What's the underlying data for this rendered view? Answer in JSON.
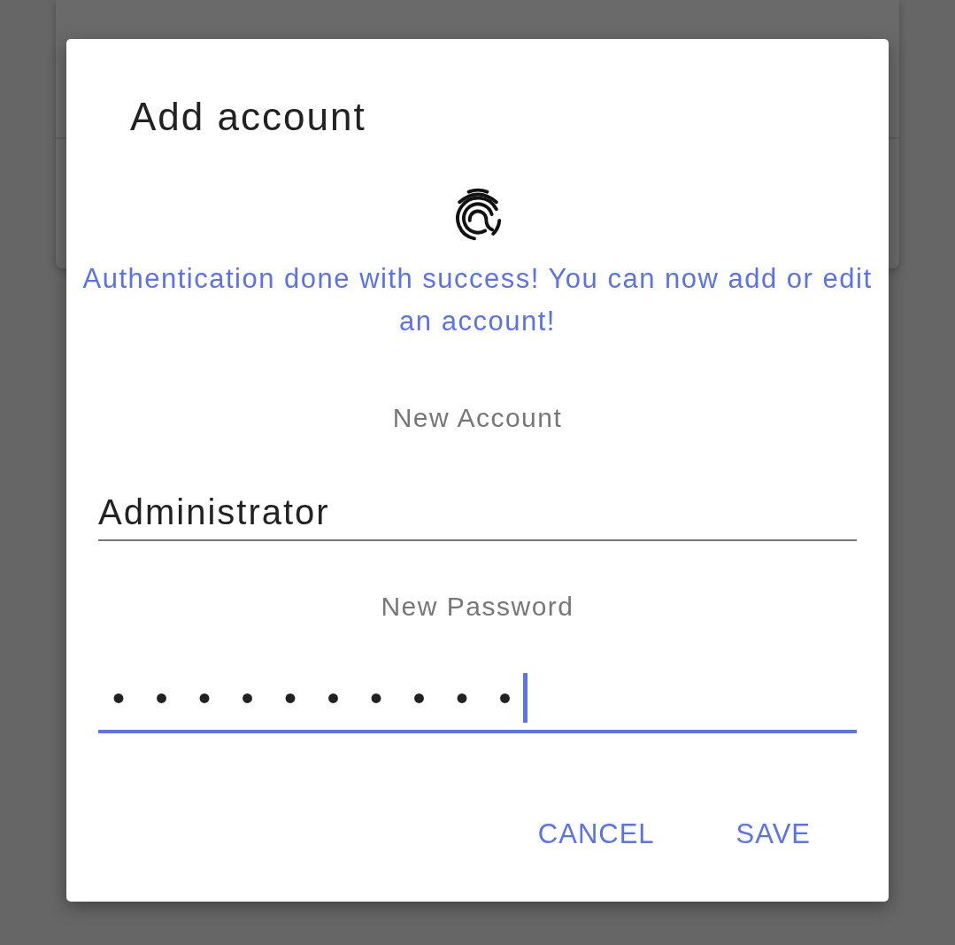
{
  "dialog": {
    "title": "Add account",
    "message": "Authentication done with success! You can now add or edit an account!",
    "fields": [
      {
        "label": "New Account",
        "kind": "text",
        "value": "Administrator",
        "focused": false
      },
      {
        "label": "New Password",
        "kind": "password",
        "value": "••••••••••",
        "focused": true
      }
    ],
    "buttons": [
      {
        "label": "CANCEL"
      },
      {
        "label": "SAVE"
      }
    ]
  }
}
